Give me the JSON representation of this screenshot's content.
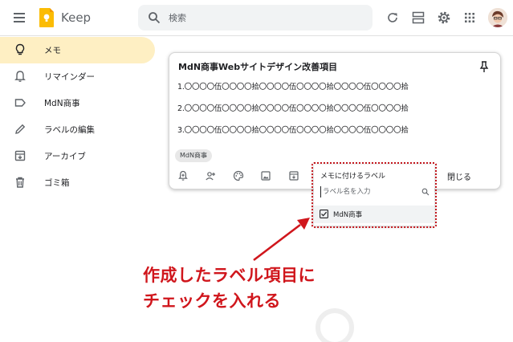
{
  "header": {
    "app_title": "Keep",
    "search_placeholder": "検索"
  },
  "sidebar": {
    "items": [
      {
        "label": "メモ",
        "icon": "lightbulb-icon",
        "active": true
      },
      {
        "label": "リマインダー",
        "icon": "bell-icon",
        "active": false
      },
      {
        "label": "MdN商事",
        "icon": "label-icon",
        "active": false
      },
      {
        "label": "ラベルの編集",
        "icon": "pencil-icon",
        "active": false
      },
      {
        "label": "アーカイブ",
        "icon": "archive-icon",
        "active": false
      },
      {
        "label": "ゴミ箱",
        "icon": "trash-icon",
        "active": false
      }
    ]
  },
  "note": {
    "title": "MdN商事Webサイトデザイン改善項目",
    "lines": [
      "1.〇〇〇〇伍〇〇〇〇拾〇〇〇〇伍〇〇〇〇拾〇〇〇〇伍〇〇〇〇拾",
      "2.〇〇〇〇伍〇〇〇〇拾〇〇〇〇伍〇〇〇〇拾〇〇〇〇伍〇〇〇〇拾",
      "3.〇〇〇〇伍〇〇〇〇拾〇〇〇〇伍〇〇〇〇拾〇〇〇〇伍〇〇〇〇拾"
    ],
    "label_chip": "MdN商事",
    "close_label": "閉じる"
  },
  "label_popup": {
    "title": "メモに付けるラベル",
    "input_placeholder": "ラベル名を入力",
    "options": [
      {
        "label": "MdN商事",
        "checked": true
      }
    ]
  },
  "annotation": {
    "line1": "作成したラベル項目に",
    "line2": "チェックを入れる"
  },
  "colors": {
    "active_nav": "#feefc3",
    "annotation_red": "#d0161c",
    "keep_yellow": "#fbbc04"
  }
}
